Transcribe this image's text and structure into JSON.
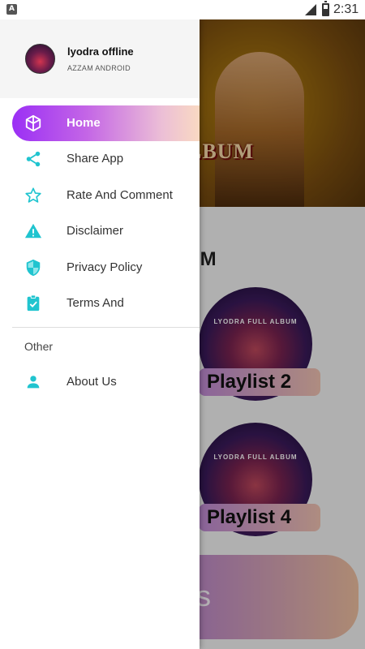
{
  "status_bar": {
    "app_badge": "A",
    "time": "2:31"
  },
  "drawer": {
    "user": {
      "name": "lyodra offline",
      "subtitle": "AZZAM ANDROID"
    },
    "items": [
      {
        "label": "Home",
        "icon": "cube-icon"
      },
      {
        "label": "Share App",
        "icon": "share-icon"
      },
      {
        "label": "Rate And Comment",
        "icon": "star-icon"
      },
      {
        "label": "Disclaimer",
        "icon": "warning-icon"
      },
      {
        "label": "Privacy Policy",
        "icon": "shield-icon"
      },
      {
        "label": "Terms And",
        "icon": "clipboard-check-icon"
      }
    ],
    "other_section": "Other",
    "other_items": [
      {
        "label": "About Us",
        "icon": "person-icon"
      }
    ]
  },
  "background": {
    "hero_text": "LL ALBUM",
    "section_title": "ALBUM",
    "cards": [
      {
        "disc_title": "LYODRA FULL ALBUM",
        "label": "Playlist 2"
      },
      {
        "disc_title": "LYODRA FULL ALBUM",
        "label": "Playlist 4"
      }
    ],
    "pill_text": "pps"
  },
  "colors": {
    "accent": "#20c4cf",
    "active_start": "#9b2ff5",
    "active_end": "#f9d9c2"
  }
}
